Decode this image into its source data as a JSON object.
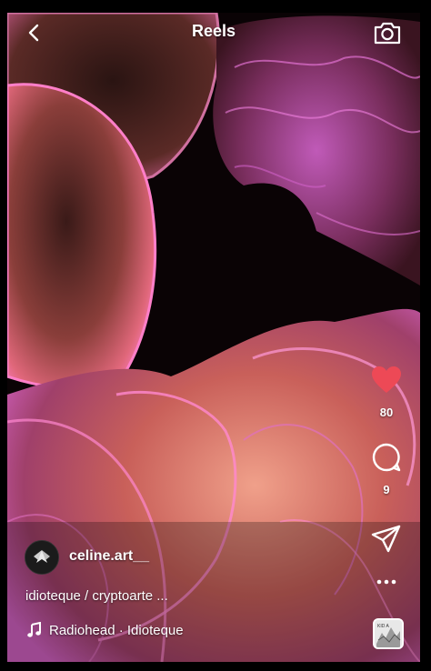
{
  "header": {
    "title": "Reels",
    "back_icon": "chevron-left-icon",
    "camera_icon": "camera-icon"
  },
  "actions": {
    "like_icon": "heart-icon",
    "like_count": "80",
    "like_color": "#ed4956",
    "comment_icon": "comment-icon",
    "comment_count": "9",
    "share_icon": "paper-plane-icon",
    "more_icon": "more-dots-icon"
  },
  "post": {
    "username": "celine.art__",
    "caption": "idioteque / cryptoarte ...",
    "music_icon": "music-note-icon",
    "music": "Radiohead · Idioteque",
    "album_thumb_text": "KID A"
  }
}
